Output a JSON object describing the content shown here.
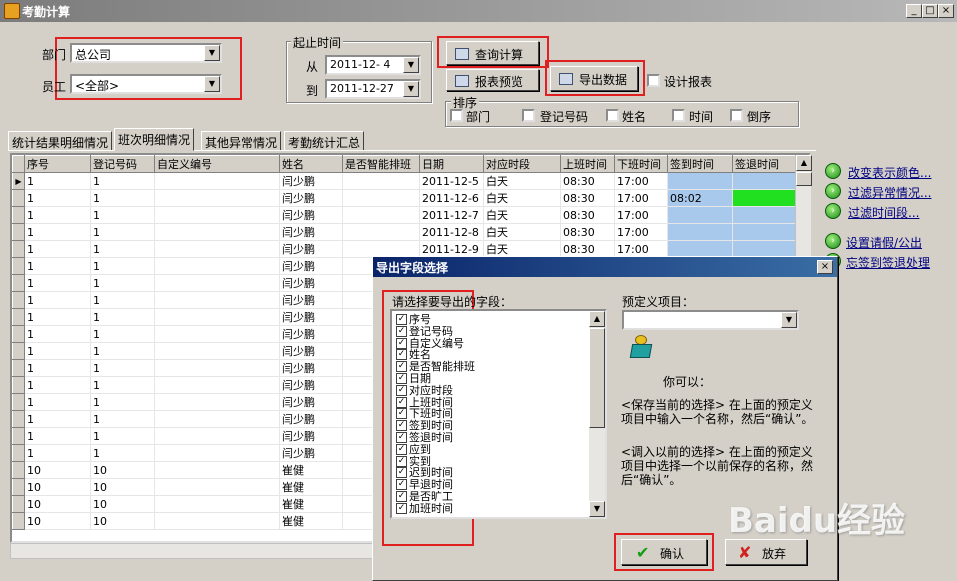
{
  "window": {
    "title": "考勤计算"
  },
  "filters": {
    "dept_label": "部门",
    "dept_value": "总公司",
    "emp_label": "员工",
    "emp_value": "<全部>"
  },
  "time_range": {
    "title": "起止时间",
    "from_label": "从",
    "from_value": "2011-12- 4",
    "to_label": "到",
    "to_value": "2011-12-27"
  },
  "toolbar": {
    "query": "查询计算",
    "preview": "报表预览",
    "export": "导出数据",
    "design": "设计报表"
  },
  "sort": {
    "title": "排序",
    "options": [
      "部门",
      "登记号码",
      "姓名",
      "时间",
      "倒序"
    ]
  },
  "tabs": [
    "统计结果明细情况",
    "班次明细情况",
    "其他异常情况",
    "考勤统计汇总"
  ],
  "table": {
    "columns": [
      "序号",
      "登记号码",
      "自定义编号",
      "姓名",
      "是否智能排班",
      "日期",
      "对应时段",
      "上班时间",
      "下班时间",
      "签到时间",
      "签退时间"
    ],
    "rows": [
      [
        "1",
        "1",
        "",
        "闫少鹏",
        "",
        "2011-12-5",
        "白天",
        "08:30",
        "17:00",
        "",
        ""
      ],
      [
        "1",
        "1",
        "",
        "闫少鹏",
        "",
        "2011-12-6",
        "白天",
        "08:30",
        "17:00",
        "08:02",
        ""
      ],
      [
        "1",
        "1",
        "",
        "闫少鹏",
        "",
        "2011-12-7",
        "白天",
        "08:30",
        "17:00",
        "",
        ""
      ],
      [
        "1",
        "1",
        "",
        "闫少鹏",
        "",
        "2011-12-8",
        "白天",
        "08:30",
        "17:00",
        "",
        ""
      ],
      [
        "1",
        "1",
        "",
        "闫少鹏",
        "",
        "2011-12-9",
        "白天",
        "08:30",
        "17:00",
        "",
        ""
      ],
      [
        "1",
        "1",
        "",
        "闫少鹏",
        "",
        "",
        "",
        "",
        "",
        "",
        ""
      ],
      [
        "1",
        "1",
        "",
        "闫少鹏",
        "",
        "",
        "",
        "",
        "",
        "",
        ""
      ],
      [
        "1",
        "1",
        "",
        "闫少鹏",
        "",
        "",
        "",
        "",
        "",
        "",
        ""
      ],
      [
        "1",
        "1",
        "",
        "闫少鹏",
        "",
        "",
        "",
        "",
        "",
        "",
        ""
      ],
      [
        "1",
        "1",
        "",
        "闫少鹏",
        "",
        "",
        "",
        "",
        "",
        "",
        ""
      ],
      [
        "1",
        "1",
        "",
        "闫少鹏",
        "",
        "",
        "",
        "",
        "",
        "",
        ""
      ],
      [
        "1",
        "1",
        "",
        "闫少鹏",
        "",
        "",
        "",
        "",
        "",
        "",
        ""
      ],
      [
        "1",
        "1",
        "",
        "闫少鹏",
        "",
        "",
        "",
        "",
        "",
        "",
        ""
      ],
      [
        "1",
        "1",
        "",
        "闫少鹏",
        "",
        "",
        "",
        "",
        "",
        "",
        ""
      ],
      [
        "1",
        "1",
        "",
        "闫少鹏",
        "",
        "",
        "",
        "",
        "",
        "",
        ""
      ],
      [
        "1",
        "1",
        "",
        "闫少鹏",
        "",
        "",
        "",
        "",
        "",
        "",
        ""
      ],
      [
        "1",
        "1",
        "",
        "闫少鹏",
        "",
        "",
        "",
        "",
        "",
        "",
        ""
      ],
      [
        "10",
        "10",
        "",
        "崔健",
        "",
        "",
        "",
        "",
        "",
        "",
        ""
      ],
      [
        "10",
        "10",
        "",
        "崔健",
        "",
        "",
        "",
        "",
        "",
        "",
        ""
      ],
      [
        "10",
        "10",
        "",
        "崔健",
        "",
        "",
        "",
        "",
        "",
        "",
        ""
      ],
      [
        "10",
        "10",
        "",
        "崔健",
        "",
        "",
        "",
        "",
        "",
        "",
        ""
      ]
    ]
  },
  "side_links": [
    "改变表示颜色...",
    "过滤异常情况...",
    "过滤时间段...",
    "设置请假/公出",
    "忘签到签退处理"
  ],
  "dialog": {
    "title": "导出字段选择",
    "fields_label": "请选择要导出的字段：",
    "fields": [
      "序号",
      "登记号码",
      "自定义编号",
      "姓名",
      "是否智能排班",
      "日期",
      "对应时段",
      "上班时间",
      "下班时间",
      "签到时间",
      "签退时间",
      "应到",
      "实到",
      "迟到时间",
      "早退时间",
      "是否旷工",
      "加班时间"
    ],
    "preset_label": "预定义项目：",
    "preset_value": "",
    "you_can": "你可以：",
    "note1": "<保存当前的选择> 在上面的预定义项目中输入一个名称，然后“确认”。",
    "note2": "<调入以前的选择> 在上面的预定义项目中选择一个以前保存的名称，然后“确认”。",
    "ok": "确认",
    "cancel": "放弃"
  },
  "watermark": "Baidu经验"
}
